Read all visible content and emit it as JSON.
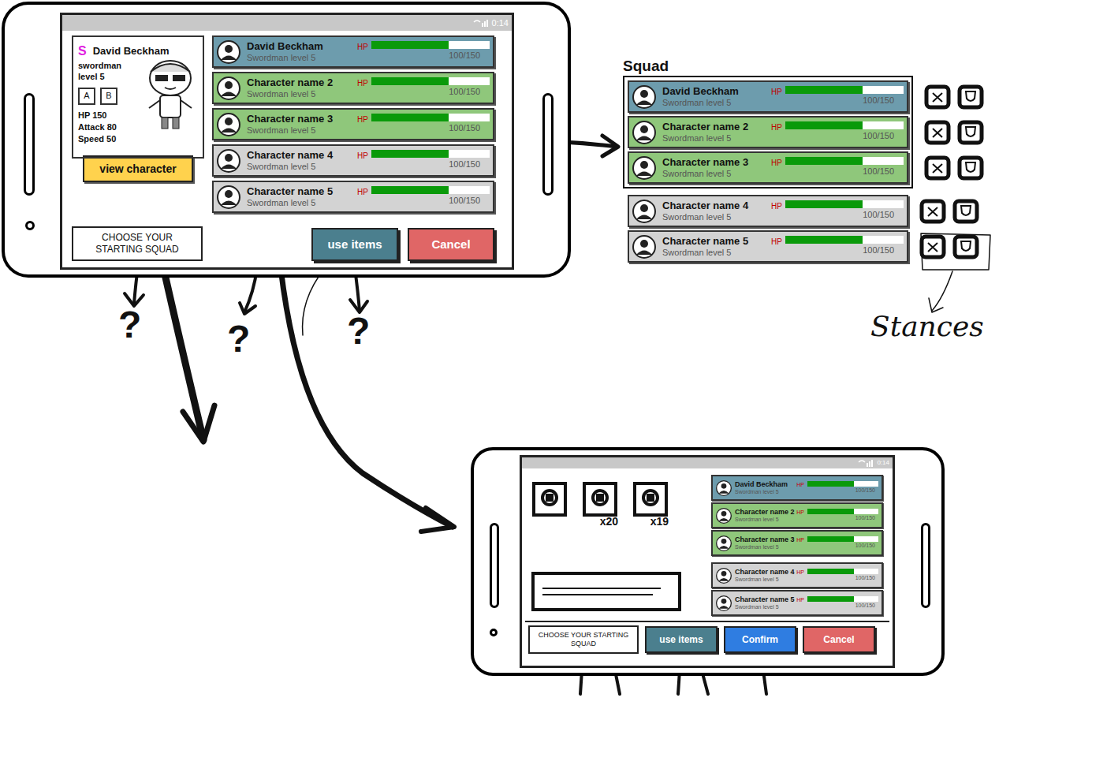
{
  "phone1": {
    "status_time": "0:14",
    "card": {
      "rank": "S",
      "name": "David Beckham",
      "class": "swordman",
      "level": "level 5",
      "skills": [
        "A",
        "B"
      ],
      "stats": [
        "HP 150",
        "Attack 80",
        "Speed 50"
      ],
      "button": "view character"
    },
    "roster": [
      {
        "name": "David Beckham",
        "subtitle": "Swordman level 5",
        "hp_label": "HP",
        "reading": "100/150",
        "level": 0.65,
        "selected": true,
        "color": "#6d9cad"
      },
      {
        "name": "Character name 2",
        "subtitle": "Swordman level 5",
        "hp_label": "HP",
        "reading": "100/150",
        "level": 0.65,
        "selected": false,
        "color": "#8fc77b"
      },
      {
        "name": "Character name 3",
        "subtitle": "Swordman level 5",
        "hp_label": "HP",
        "reading": "100/150",
        "level": 0.65,
        "selected": false,
        "color": "#8fc77b"
      },
      {
        "name": "Character name 4",
        "subtitle": "Swordman level 5",
        "hp_label": "HP",
        "reading": "100/150",
        "level": 0.65,
        "selected": false,
        "color": "#d3d3d3"
      },
      {
        "name": "Character name 5",
        "subtitle": "Swordman level 5",
        "hp_label": "HP",
        "reading": "100/150",
        "level": 0.65,
        "selected": false,
        "color": "#d3d3d3"
      }
    ],
    "buttons": {
      "squad": "CHOOSE YOUR STARTING SQUAD",
      "items": "use items",
      "cancel": "Cancel"
    }
  },
  "questions": [
    "?",
    "?",
    "?"
  ],
  "squad_panel": {
    "title": "Squad",
    "stances_label": "Stances",
    "rows": [
      {
        "name": "David Beckham",
        "subtitle": "Swordman level 5",
        "hp_label": "HP",
        "reading": "100/150",
        "level": 0.65,
        "in_squad": true,
        "color": "#6d9cad"
      },
      {
        "name": "Character name 2",
        "subtitle": "Swordman level 5",
        "hp_label": "HP",
        "reading": "100/150",
        "level": 0.65,
        "in_squad": true,
        "color": "#8fc77b"
      },
      {
        "name": "Character name 3",
        "subtitle": "Swordman level 5",
        "hp_label": "HP",
        "reading": "100/150",
        "level": 0.65,
        "in_squad": true,
        "color": "#8fc77b"
      },
      {
        "name": "Character name 4",
        "subtitle": "Swordman level 5",
        "hp_label": "HP",
        "reading": "100/150",
        "level": 0.65,
        "in_squad": false,
        "color": "#d3d3d3"
      },
      {
        "name": "Character name 5",
        "subtitle": "Swordman level 5",
        "hp_label": "HP",
        "reading": "100/150",
        "level": 0.65,
        "in_squad": false,
        "color": "#d3d3d3"
      }
    ]
  },
  "phone2": {
    "status_time": "0:14",
    "items": [
      {
        "count": ""
      },
      {
        "count": "x20"
      },
      {
        "count": "x19"
      }
    ],
    "roster": [
      {
        "name": "David Beckham",
        "subtitle": "Swordman level 5",
        "hp_label": "HP",
        "reading": "100/150",
        "level": 0.65,
        "in_squad": true,
        "color": "#6d9cad"
      },
      {
        "name": "Character name 2",
        "subtitle": "Swordman level 5",
        "hp_label": "HP",
        "reading": "100/150",
        "level": 0.65,
        "in_squad": true,
        "color": "#8fc77b"
      },
      {
        "name": "Character name 3",
        "subtitle": "Swordman level 5",
        "hp_label": "HP",
        "reading": "100/150",
        "level": 0.65,
        "in_squad": true,
        "color": "#8fc77b"
      },
      {
        "name": "Character name 4",
        "subtitle": "Swordman level 5",
        "hp_label": "HP",
        "reading": "100/150",
        "level": 0.65,
        "in_squad": false,
        "color": "#d3d3d3"
      },
      {
        "name": "Character name 5",
        "subtitle": "Swordman level 5",
        "hp_label": "HP",
        "reading": "100/150",
        "level": 0.65,
        "in_squad": false,
        "color": "#d3d3d3"
      }
    ],
    "buttons": {
      "squad": "CHOOSE YOUR STARTING SQUAD",
      "items": "use items",
      "confirm": "Confirm",
      "cancel": "Cancel"
    }
  }
}
